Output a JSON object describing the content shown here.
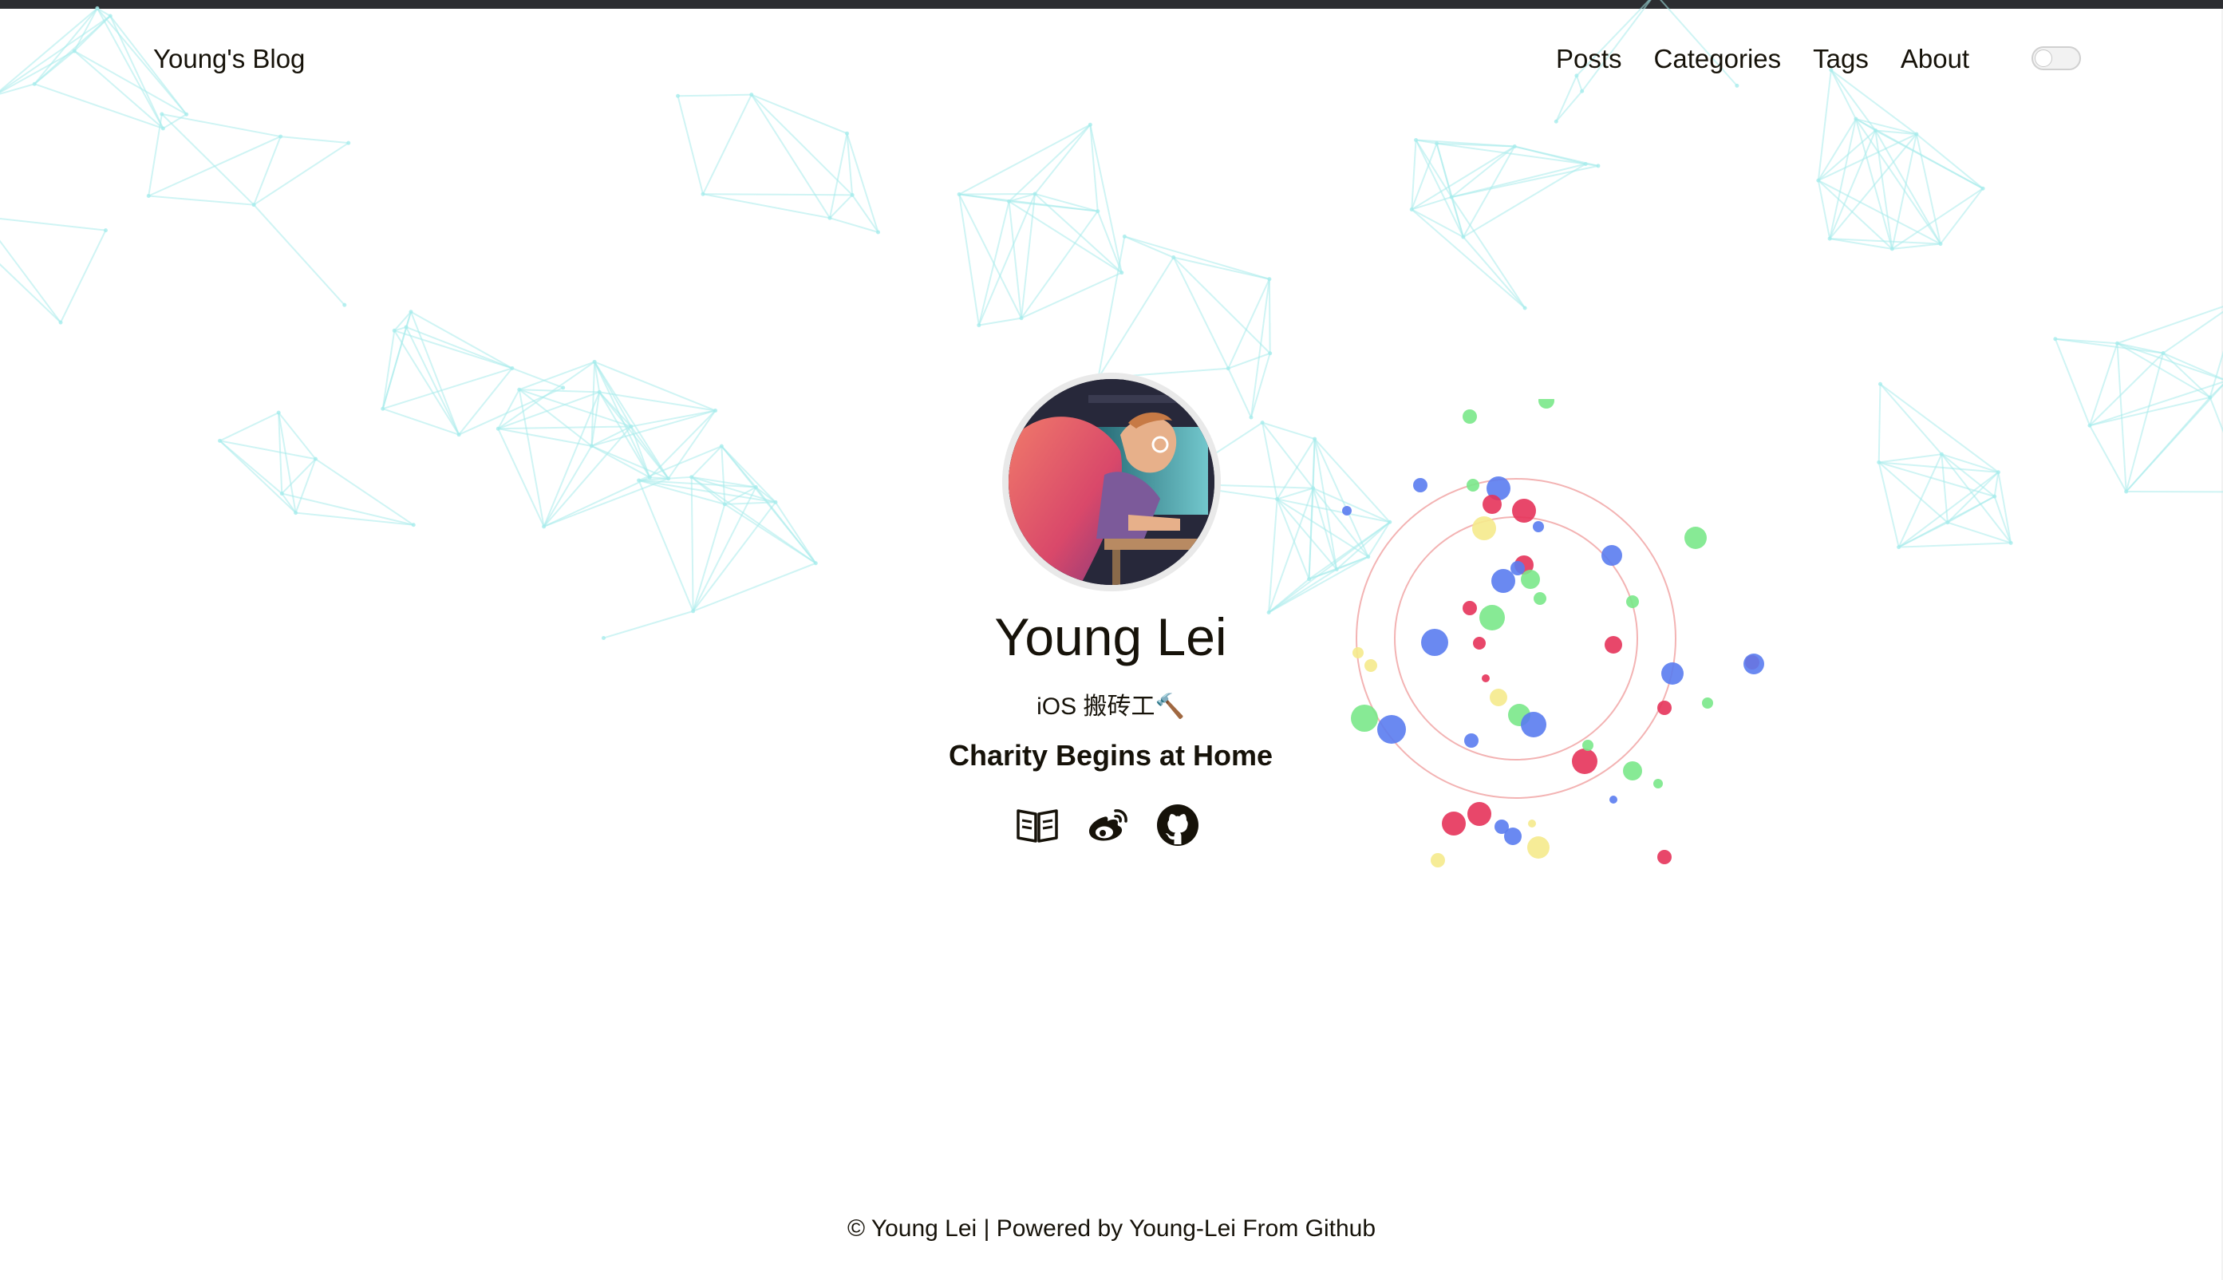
{
  "header": {
    "brand": "Young's Blog",
    "menu": [
      {
        "label": "Posts"
      },
      {
        "label": "Categories"
      },
      {
        "label": "Tags"
      },
      {
        "label": "About"
      }
    ],
    "theme_toggle": "theme-switch-icon"
  },
  "profile": {
    "name": "Young Lei",
    "subtitle": "iOS 搬砖工🔨",
    "motto": "Charity Begins at Home",
    "social": [
      {
        "icon": "book-icon"
      },
      {
        "icon": "weibo-icon"
      },
      {
        "icon": "github-icon"
      }
    ]
  },
  "footer": {
    "copyright": "© Young Lei",
    "separator": "|",
    "powered_prefix": "Powered by",
    "powered_link": "Young-Lei",
    "powered_suffix": "From Github"
  },
  "colors": {
    "text": "#161209",
    "background": "#ffffff",
    "top_bar": "#2c2d31",
    "network_lines": "#a8ecec",
    "ball_red": "#e6335a",
    "ball_blue": "#5a7cf0",
    "ball_green": "#7ae88a",
    "ball_yellow": "#f5ea8c",
    "clock_ring": "#f3b3b3"
  }
}
